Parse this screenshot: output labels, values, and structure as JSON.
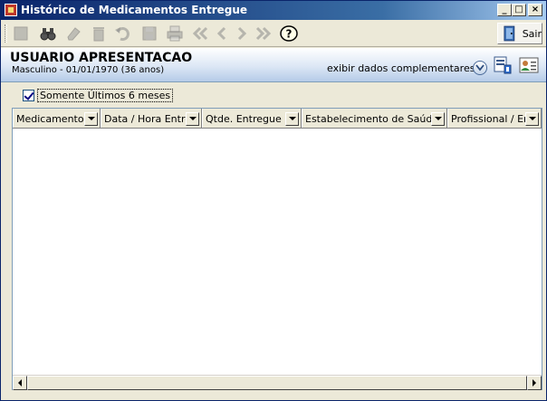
{
  "window": {
    "title": "Histórico de Medicamentos Entregue",
    "minimize_glyph": "_",
    "maximize_glyph": "□",
    "close_glyph": "×"
  },
  "toolbar": {
    "buttons": [
      {
        "icon": "new-icon",
        "enabled": false
      },
      {
        "icon": "binoculars-icon",
        "enabled": true
      },
      {
        "icon": "eraser-icon",
        "enabled": false
      },
      {
        "icon": "trash-icon",
        "enabled": false
      },
      {
        "icon": "undo-icon",
        "enabled": false
      },
      {
        "icon": "save-icon",
        "enabled": false
      },
      {
        "icon": "print-icon",
        "enabled": false
      },
      {
        "icon": "first-icon",
        "enabled": false
      },
      {
        "icon": "prev-icon",
        "enabled": false
      },
      {
        "icon": "next-icon",
        "enabled": false
      },
      {
        "icon": "last-icon",
        "enabled": false
      },
      {
        "icon": "help-icon",
        "enabled": true
      }
    ],
    "exit_label": "Sair"
  },
  "patient": {
    "name": "USUARIO APRESENTACAO",
    "info": "Masculino - 01/01/1970 (36 anos)",
    "extra_link": "exibir dados complementares..."
  },
  "filter": {
    "checked": true,
    "label": "Somente Últimos 6 meses"
  },
  "grid": {
    "columns": [
      "Medicamento",
      "Data / Hora Entrega",
      "Qtde. Entregue",
      "Estabelecimento de Saúde",
      "Profissional / Entregador"
    ],
    "rows": []
  }
}
